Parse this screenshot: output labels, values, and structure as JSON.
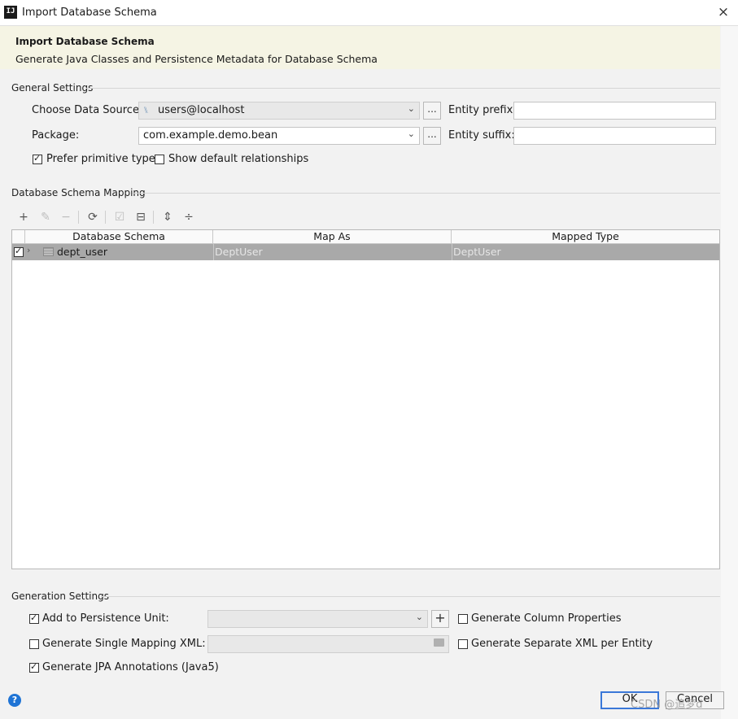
{
  "window": {
    "title": "Import Database Schema",
    "close_icon": "×"
  },
  "banner": {
    "title": "Import Database Schema",
    "subtitle": "Generate Java Classes and Persistence Metadata for Database Schema"
  },
  "general": {
    "section_title": "General Settings",
    "data_source_label": "Choose Data Source:",
    "data_source_value": "users@localhost",
    "package_label": "Package:",
    "package_value": "com.example.demo.bean",
    "browse_label": "...",
    "entity_prefix_label": "Entity prefix:",
    "entity_prefix_value": "",
    "entity_suffix_label": "Entity suffix:",
    "entity_suffix_value": "",
    "prefer_primitive_label": "Prefer primitive types",
    "prefer_primitive_checked": true,
    "show_relationships_label": "Show default relationships",
    "show_relationships_checked": false
  },
  "mapping": {
    "section_title": "Database Schema Mapping",
    "toolbar": [
      {
        "name": "add-icon",
        "glyph": "+",
        "enabled": true
      },
      {
        "name": "edit-icon",
        "glyph": "✎",
        "enabled": false
      },
      {
        "name": "remove-icon",
        "glyph": "−",
        "enabled": false
      },
      {
        "name": "refresh-icon",
        "glyph": "⟳",
        "enabled": true
      },
      {
        "name": "check-all-icon",
        "glyph": "☑",
        "enabled": false
      },
      {
        "name": "uncheck-icon",
        "glyph": "⊟",
        "enabled": true
      },
      {
        "name": "expand-all-icon",
        "glyph": "⇕",
        "enabled": true
      },
      {
        "name": "collapse-all-icon",
        "glyph": "÷",
        "enabled": true
      }
    ],
    "columns": [
      "Database Schema",
      "Map As",
      "Mapped Type"
    ],
    "rows": [
      {
        "checked": true,
        "schema": "dept_user",
        "map_as": "DeptUser",
        "mapped_type": "DeptUser"
      }
    ]
  },
  "generation": {
    "section_title": "Generation Settings",
    "add_persistence_label": "Add to Persistence Unit:",
    "add_persistence_checked": true,
    "persistence_unit_value": "",
    "add_unit_button": "+",
    "single_mapping_label": "Generate Single Mapping XML:",
    "single_mapping_checked": false,
    "single_mapping_value": "",
    "jpa_annotations_label": "Generate JPA Annotations (Java5)",
    "jpa_annotations_checked": true,
    "column_props_label": "Generate Column Properties",
    "column_props_checked": false,
    "separate_xml_label": "Generate Separate XML per Entity",
    "separate_xml_checked": false
  },
  "footer": {
    "help_icon": "?",
    "ok_label": "OK",
    "cancel_label": "Cancel",
    "watermark": "CSDN @追梦d"
  },
  "colors": {
    "banner_bg": "#f5f4e4",
    "selected_row": "#a9a9a9",
    "primary_border": "#3b78d8",
    "help_blue": "#1f74d5"
  }
}
